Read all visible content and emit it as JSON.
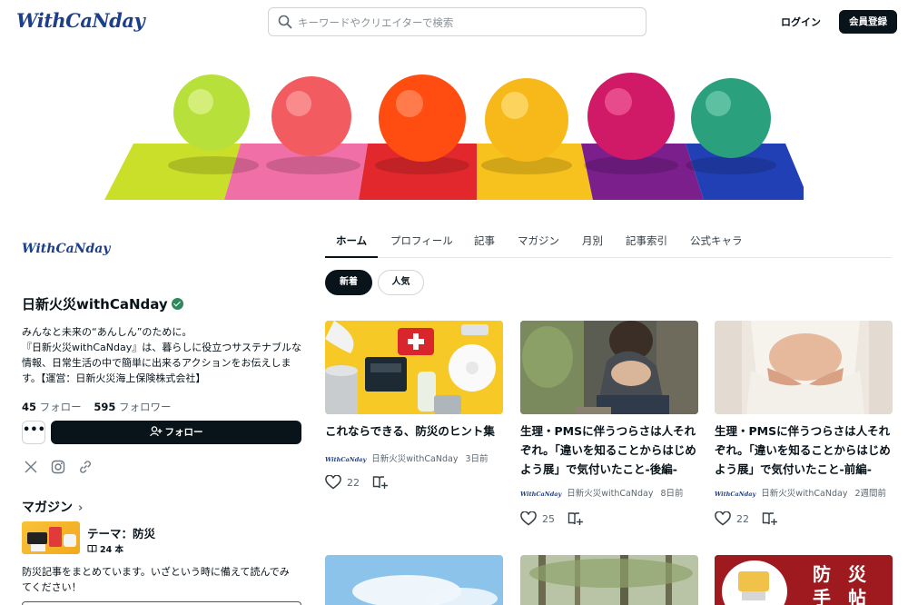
{
  "header": {
    "logo_text": "WithCaNday",
    "search_placeholder": "キーワードやクリエイターで検索",
    "login_label": "ログイン",
    "signup_label": "会員登録"
  },
  "profile": {
    "logo_text": "WithCaNday",
    "name": "日新火災withCaNday",
    "bio_lines": [
      "みんなと未来の“あんしん”のために。",
      "『日新火災withCaNday』は、暮らしに役立つサステナブルな",
      "情報、日常生活の中で簡単に出来るアクションをお伝えしま",
      "す。【運営：日新火災海上保険株式会社】"
    ],
    "following_count": "45",
    "following_label": "フォロー",
    "follower_count": "595",
    "follower_label": "フォロワー",
    "more_label": "•••",
    "follow_button_label": "フォロー",
    "socials": [
      "x-icon",
      "instagram-icon",
      "link-icon"
    ]
  },
  "magazine": {
    "heading": "マガジン",
    "title": "テーマ：防災",
    "count": "24 本",
    "description_lines": [
      "防災記事をまとめています。いざという時に備えて読んでみ",
      "てください！"
    ]
  },
  "tabs": [
    "ホーム",
    "プロフィール",
    "記事",
    "マガジン",
    "月別",
    "記事索引",
    "公式キャラ"
  ],
  "filters": {
    "new_label": "新着",
    "popular_label": "人気"
  },
  "articles": [
    {
      "title_lines": [
        "これならできる、防災のヒント集"
      ],
      "author": "日新火災withCaNday",
      "mini_logo": "WithCaNday",
      "date": "3日前",
      "likes": "22"
    },
    {
      "title_lines": [
        "生理・PMSに伴うつらさは人それ",
        "ぞれ。「違いを知ることからはじめ",
        "よう展」で気付いたこと-後編-"
      ],
      "author": "日新火災withCaNday",
      "mini_logo": "WithCaNday",
      "date": "8日前",
      "likes": "25"
    },
    {
      "title_lines": [
        "生理・PMSに伴うつらさは人それ",
        "ぞれ。「違いを知ることからはじめ",
        "よう展」で気付いたこと-前編-"
      ],
      "author": "日新火災withCaNday",
      "mini_logo": "WithCaNday",
      "date": "2週間前",
      "likes": "22"
    }
  ],
  "bottom_card_text": "防 災 手 帖",
  "colors": {
    "brand_dark": "#08131a",
    "brand_blue": "#1c3f8c",
    "verified_green": "#2e8a5e"
  }
}
